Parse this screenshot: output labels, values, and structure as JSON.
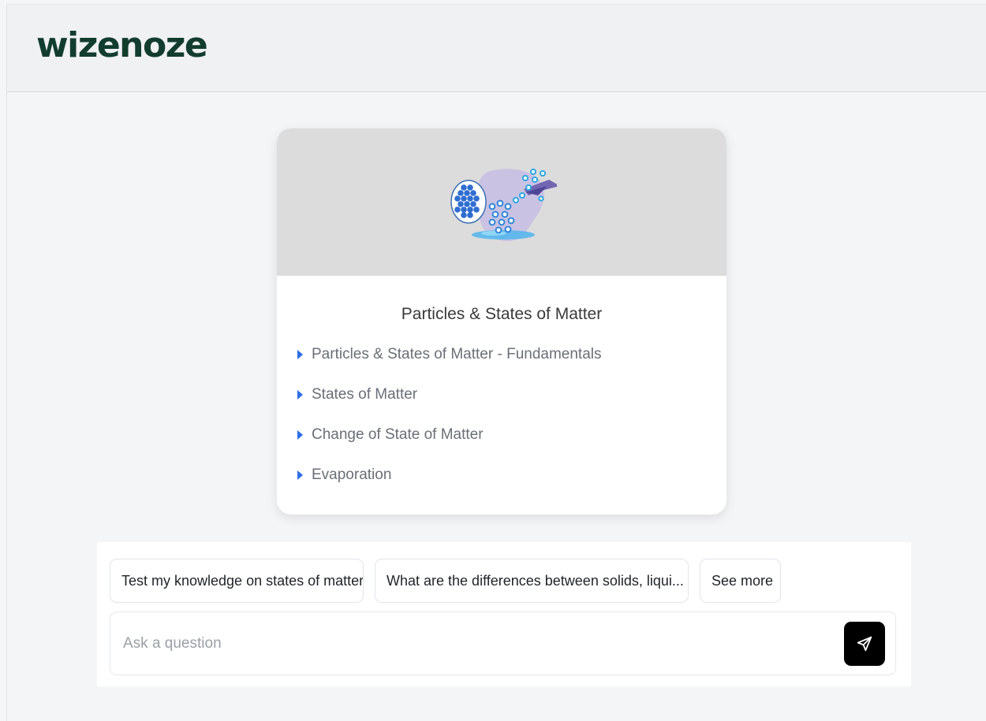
{
  "header": {
    "logo_text": "wizenoze"
  },
  "topic_card": {
    "title": "Particles & States of Matter",
    "image_icon": "particles-illustration",
    "items": [
      {
        "label": "Particles & States of Matter - Fundamentals"
      },
      {
        "label": "States of Matter"
      },
      {
        "label": "Change of State of Matter"
      },
      {
        "label": "Evaporation"
      }
    ]
  },
  "suggestions": [
    {
      "label": "Test my knowledge on states of matter"
    },
    {
      "label": "What are the differences between solids, liqui..."
    },
    {
      "label": "See more"
    }
  ],
  "ask": {
    "placeholder": "Ask a question",
    "value": "",
    "send_icon": "send-icon"
  },
  "colors": {
    "logo": "#123d2e",
    "accent_arrow": "#2c6ee6",
    "send_button": "#000000",
    "hero_background": "#dcdcdc"
  }
}
